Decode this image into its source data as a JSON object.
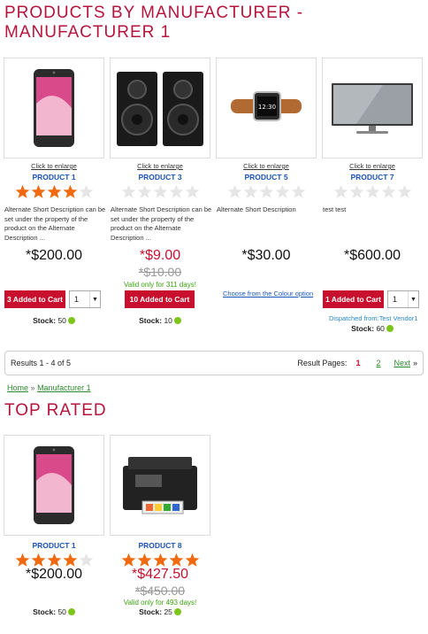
{
  "section1": {
    "title_line1": "PRODUCTS BY MANUFACTURER -",
    "title_line2": "MANUFACTURER 1",
    "products": [
      {
        "name": "PRODUCT 1",
        "enlarge": "Click to enlarge",
        "rating": 4,
        "image": "smartphone-image",
        "description": "Alternate Short Description can be set under the property of the product on the Alternate Description ...",
        "price": "*$200.00",
        "cart_label": "3 Added to Cart",
        "qty": "1",
        "stock_label": "Stock:",
        "stock_value": "50"
      },
      {
        "name": "PRODUCT 3",
        "enlarge": "Click to enlarge",
        "rating": 0,
        "image": "speakers-image",
        "description": "Alternate Short Description can be set under the property of the product on the Alternate Description ...",
        "price": "*$9.00",
        "old_price": "*$10.00",
        "valid": "Valid only for 311 days!",
        "cart_label": "10 Added to Cart",
        "stock_label": "Stock:",
        "stock_value": "10"
      },
      {
        "name": "PRODUCT 5",
        "enlarge": "Click to enlarge",
        "rating": 0,
        "image": "smartwatch-image",
        "description": "Alternate Short Description",
        "price": "*$30.00",
        "colour_link": "Choose from the Colour option"
      },
      {
        "name": "PRODUCT 7",
        "enlarge": "Click to enlarge",
        "rating": 0,
        "image": "television-image",
        "description": "test test",
        "price": "*$600.00",
        "cart_label": "1 Added to Cart",
        "qty": "1",
        "vendor": "Dispatched from:Test Vendor1",
        "stock_label": "Stock:",
        "stock_value": "60"
      }
    ]
  },
  "pager": {
    "results": "Results 1 - 4 of 5",
    "label": "Result Pages:",
    "current": "1",
    "page2": "2",
    "next": "Next",
    "next_arrow": "»"
  },
  "breadcrumb": {
    "home": "Home",
    "sep": "»",
    "current": "Manufacturer 1"
  },
  "section2": {
    "title": "TOP RATED",
    "products": [
      {
        "name": "PRODUCT 1",
        "rating": 4,
        "image": "smartphone-image",
        "price": "*$200.00",
        "stock_label": "Stock:",
        "stock_value": "50"
      },
      {
        "name": "PRODUCT 8",
        "rating": 5,
        "image": "printer-image",
        "price": "*$427.50",
        "old_price": "*$450.00",
        "valid": "Valid only for 493 days!",
        "stock_label": "Stock:",
        "stock_value": "25"
      }
    ]
  },
  "colors": {
    "heading": "#b5143c",
    "star_on": "#f26a10",
    "star_off": "#e6e6e6",
    "cart_button": "#c8102e",
    "link": "#1a56b8",
    "stock_dot": "#7cc61c"
  }
}
